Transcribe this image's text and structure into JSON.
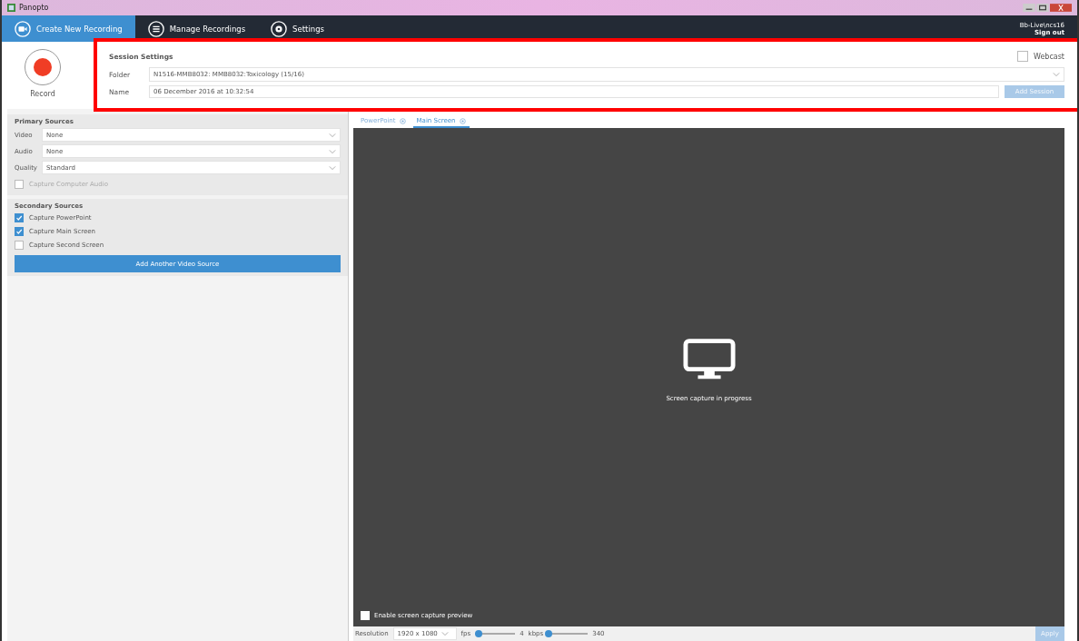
{
  "window": {
    "title": "Panopto"
  },
  "nav": {
    "tabs": [
      {
        "label": "Create New Recording",
        "selected": true
      },
      {
        "label": "Manage Recordings",
        "selected": false
      },
      {
        "label": "Settings",
        "selected": false
      }
    ],
    "user": "Bb-Live\\ncs16",
    "sign_out": "Sign out"
  },
  "record": {
    "label": "Record"
  },
  "session": {
    "title": "Session Settings",
    "webcast": {
      "label": "Webcast",
      "checked": false
    },
    "folder": {
      "label": "Folder",
      "value": "N1516-MMB8032: MMB8032:Toxicology (15/16)"
    },
    "name": {
      "label": "Name",
      "value": "06 December 2016 at 10:32:54"
    },
    "add_session": {
      "label": "Add Session",
      "disabled": true
    }
  },
  "primary": {
    "title": "Primary Sources",
    "fields": [
      {
        "label": "Video",
        "value": "None"
      },
      {
        "label": "Audio",
        "value": "None"
      },
      {
        "label": "Quality",
        "value": "Standard"
      }
    ],
    "computer_audio": {
      "label": "Capture Computer Audio",
      "checked": false,
      "disabled": true
    }
  },
  "secondary": {
    "title": "Secondary Sources",
    "items": [
      {
        "label": "Capture PowerPoint",
        "checked": true
      },
      {
        "label": "Capture Main Screen",
        "checked": true
      },
      {
        "label": "Capture Second Screen",
        "checked": false
      }
    ],
    "add_button": "Add Another Video Source"
  },
  "preview": {
    "tabs": [
      {
        "label": "PowerPoint",
        "selected": false
      },
      {
        "label": "Main Screen",
        "selected": true
      }
    ],
    "message": "Screen capture in progress",
    "enable_preview": {
      "label": "Enable screen capture preview",
      "checked": false
    }
  },
  "bottom": {
    "resolution_label": "Resolution",
    "resolution": "1920 x 1080",
    "fps": {
      "label": "fps",
      "level": 0.1,
      "reading": "4"
    },
    "kbps": {
      "label": "kbps",
      "level": 0.03,
      "reading": "340"
    },
    "apply": {
      "label": "Apply",
      "disabled": true
    }
  }
}
